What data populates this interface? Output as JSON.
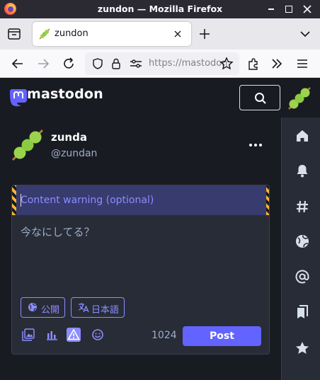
{
  "window": {
    "title": "zundon — Mozilla Firefox"
  },
  "tabs": [
    {
      "title": "zundon",
      "active": true
    }
  ],
  "navbar": {
    "url": "https://mastodon"
  },
  "header": {
    "logo_text": "mastodon"
  },
  "account": {
    "display_name": "zunda",
    "handle": "@zundan"
  },
  "composer": {
    "cw_placeholder": "Content warning (optional)",
    "placeholder": "今なにしてる？",
    "visibility_label": "公開",
    "language_label": "日本語",
    "char_count": "1024",
    "post_label": "Post"
  },
  "colors": {
    "brand": "#6364ff",
    "accent": "#8c8dff",
    "background": "#191b22",
    "panel": "#282c37",
    "warning_stripe": "#f5b530"
  },
  "icons": {
    "right_nav": [
      "home-icon",
      "notifications-icon",
      "hashtag-icon",
      "globe-icon",
      "mention-icon",
      "bookmarks-icon",
      "star-icon"
    ],
    "toolbar": [
      "media-icon",
      "poll-icon",
      "content-warning-icon",
      "emoji-icon"
    ]
  }
}
